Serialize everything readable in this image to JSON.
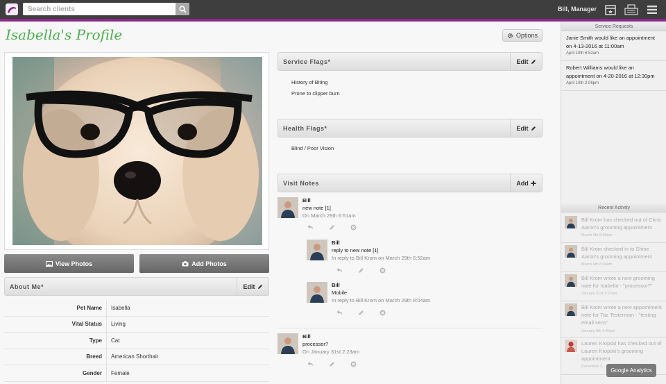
{
  "topbar": {
    "search_placeholder": "Search clients",
    "user_name": "Bill, Manager",
    "icons": [
      "calendar-icon",
      "register-icon",
      "menu-icon"
    ]
  },
  "header": {
    "title": "Isabella's Profile",
    "options_label": "Options"
  },
  "photo": {
    "view_label": "View Photos",
    "add_label": "Add Photos"
  },
  "about": {
    "title": "About Me*",
    "edit_label": "Edit",
    "rows": [
      {
        "key": "Pet Name",
        "value": "Isabella"
      },
      {
        "key": "Vital Status",
        "value": "Living"
      },
      {
        "key": "Type",
        "value": "Cat"
      },
      {
        "key": "Breed",
        "value": "American Shorthair"
      },
      {
        "key": "Gender",
        "value": "Female"
      }
    ]
  },
  "service_flags": {
    "title": "Service Flags*",
    "edit_label": "Edit",
    "items": [
      "History of Biting",
      "Prone to clipper burn"
    ]
  },
  "health_flags": {
    "title": "Health Flags*",
    "edit_label": "Edit",
    "items": [
      "Blind / Poor Vision"
    ]
  },
  "visit_notes": {
    "title": "Visit Notes",
    "add_label": "Add",
    "notes": [
      {
        "author": "Bill",
        "text": "new note [1]",
        "meta": "On March 29th 6:51am"
      },
      {
        "author": "Bill",
        "text": "reply to new note [1]",
        "meta": "In reply to Bill Krom on March 29th 6:52am"
      },
      {
        "author": "Bill",
        "text": "Mobile",
        "meta": "In reply to Bill Krom on March 29th 8:04am"
      },
      {
        "author": "Bill",
        "text": "processor?",
        "meta": "On January 31st 2:23am"
      }
    ]
  },
  "sidebar": {
    "requests_title": "Service Requests",
    "requests": [
      {
        "text": "Janie Smith would like an appointment on 4-13-2016 at 11:00am",
        "date": "April 10th 6:52am"
      },
      {
        "text": "Robert Williams would like an appointment on 4-20-2016 at 12:30pm",
        "date": "April 10th 2:06pm"
      }
    ],
    "activity_title": "Recent Activity",
    "activity": [
      {
        "text": "Bill Krom has checked out of Chris Aaron's grooming appointment",
        "date": "March 9th 8:09am"
      },
      {
        "text": "Bill Krom checked in to Shine Aaron's grooming appointment",
        "date": "March 9th 8:04am"
      },
      {
        "text": "Bill Krom wrote a new grooming note for Isabella - \"processor?\"",
        "date": "January 31st 2:23am"
      },
      {
        "text": "Bill Krom wrote a new appointment note for Taz Testerman - \"testing email sens\"",
        "date": "January 9th 4:40pm"
      },
      {
        "text": "Lauren Kropski has checked out of Lauren Kropski's grooming appointment",
        "date": "December 2..."
      }
    ]
  },
  "ga_badge": "Google Analytics"
}
